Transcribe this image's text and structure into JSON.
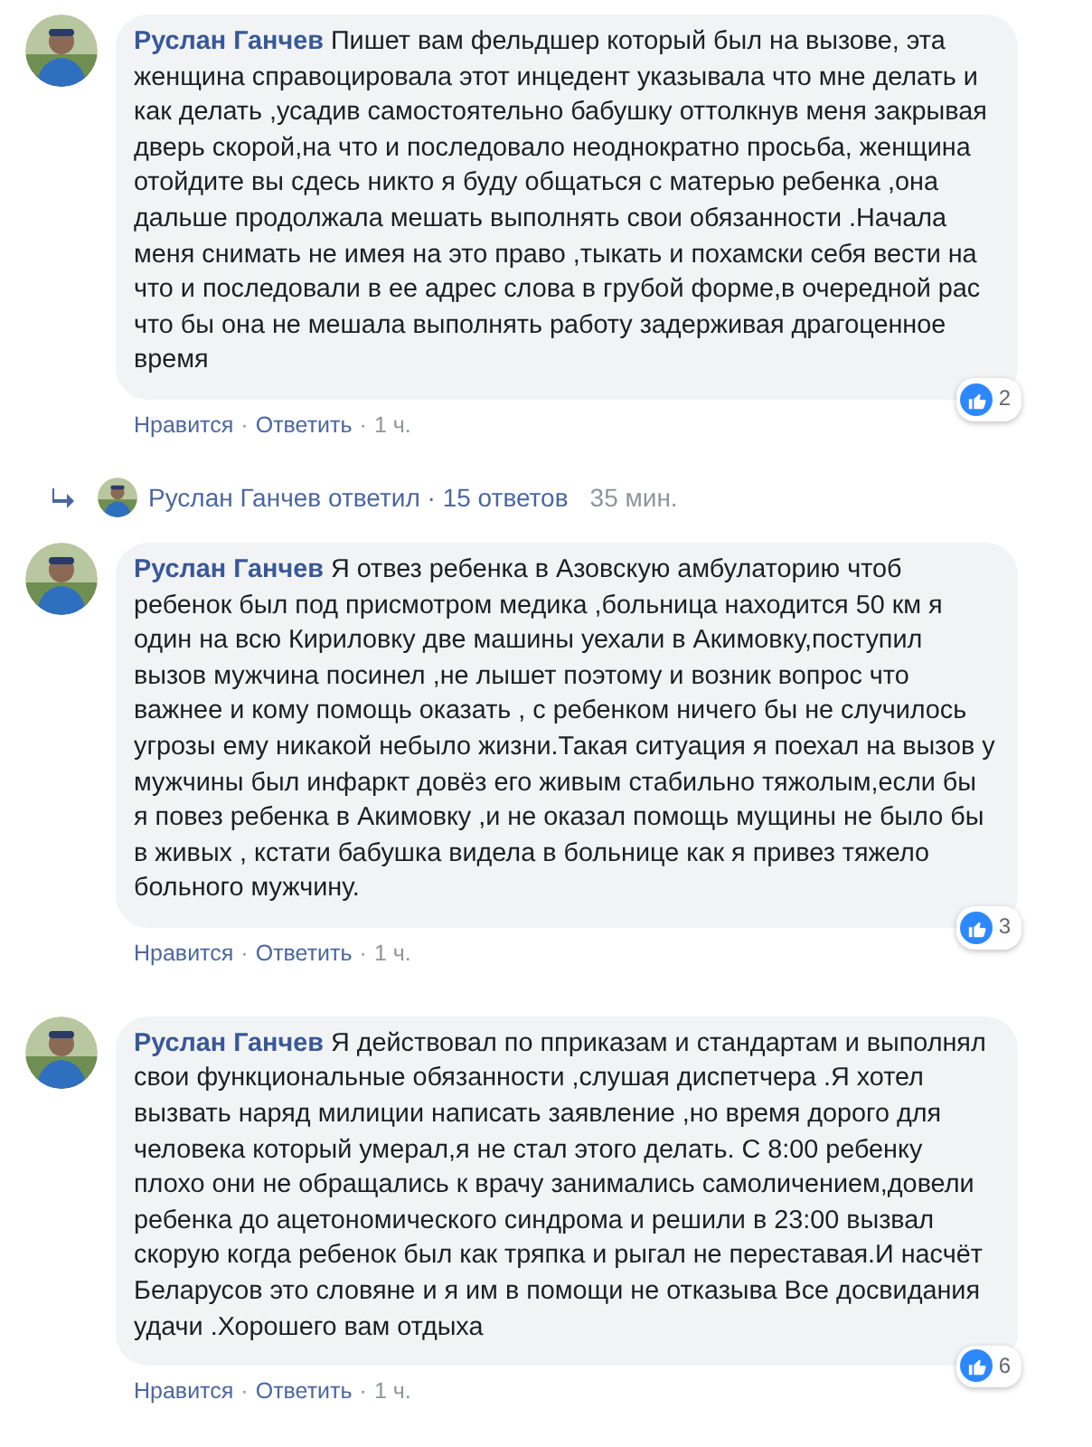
{
  "comments": [
    {
      "author": "Руслан Ганчев",
      "text": "Пишет вам фельдшер который был на вызове, эта женщина справоцировала этот инцедент указывала что мне делать и как делать ,усадив самостоятельно бабушку оттолкнув меня закрывая дверь скорой,на что и последовало неоднократно просьба, женщина отойдите вы сдесь никто я буду общаться с матерью ребенка ,она дальше продолжала мешать выполнять свои обязанности .Начала меня снимать не имея на это право ,тыкать и похамски себя вести на что и последовали в ее адрес слова в грубой форме,в очередной рас что бы она не мешала выполнять работу задерживая драгоценное время",
      "reactions": "2",
      "actions": [
        "Нравится",
        "Ответить"
      ],
      "separator": "·",
      "time": "1 ч.",
      "replies": {
        "author": "Руслан Ганчев",
        "label": "ответил",
        "separator": "·",
        "count": "15 ответов",
        "time": "35 мин."
      }
    },
    {
      "author": "Руслан Ганчев",
      "text": "Я отвез ребенка в Азовскую амбулаторию чтоб ребенок был под присмотром медика ,больница находится 50 км я один на всю Кириловку две машины уехали в Акимовку,поступил вызов мужчина посинел ,не лышет поэтому и возник вопрос что важнее и кому помощь оказать , с ребенком ничего бы не случилось угрозы ему никакой небыло жизни.Такая ситуация я поехал на вызов у мужчины был инфаркт довёз его живым стабильно тяжолым,если бы я повез ребенка в Акимовку ,и не оказал помощь мущины не было бы в живых , кстати бабушка видела в больнице как я привез тяжело больного мужчину.",
      "reactions": "3",
      "actions": [
        "Нравится",
        "Ответить"
      ],
      "separator": "·",
      "time": "1 ч."
    },
    {
      "author": "Руслан Ганчев",
      "text": "Я действовал по пприказам и стандартам и выполнял свои функциональные обязанности ,слушая диспетчера .Я хотел вызвать наряд милиции написать заявление ,но время дорого для человека который умерал,я не стал этого делать. С 8:00 ребенку плохо они не обращались к врачу занимались самоличением,довели ребенка до ацетономического синдрома и решили в 23:00 вызвал скорую когда ребенок был как тряпка и рыгал не переставая.И насчёт Беларусов это словяне и я им в помощи не отказыва Все досвидания удачи .Хорошего вам отдыха",
      "reactions": "6",
      "actions": [
        "Нравится",
        "Ответить"
      ],
      "separator": "·",
      "time": "1 ч."
    }
  ]
}
